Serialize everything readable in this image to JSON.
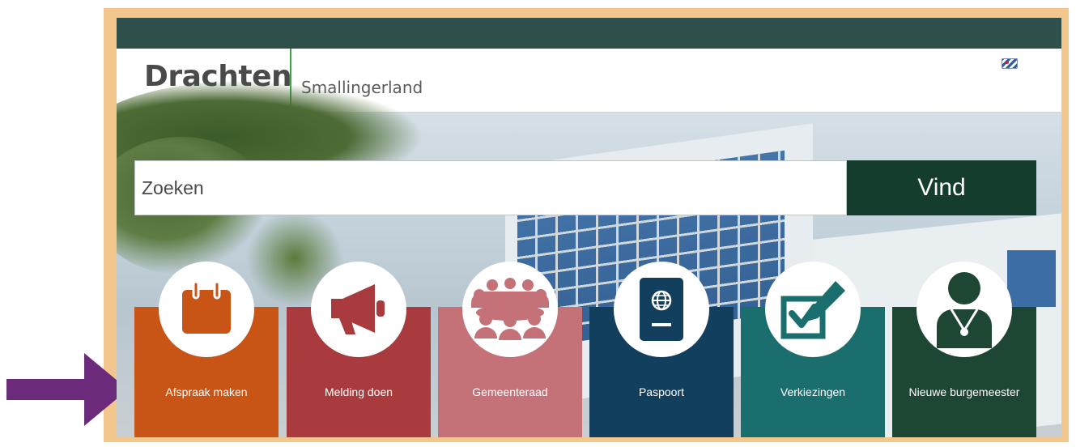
{
  "header": {
    "brand": "Drachten",
    "subbrand": "Smallingerland",
    "language_icon": "frisian-flag-icon"
  },
  "search": {
    "placeholder": "Zoeken",
    "value": "",
    "button_label": "Vind"
  },
  "tiles": [
    {
      "label": "Afspraak maken",
      "icon": "calendar-icon",
      "color": "#c85415"
    },
    {
      "label": "Melding doen",
      "icon": "megaphone-icon",
      "color": "#a93a3d"
    },
    {
      "label": "Gemeenteraad",
      "icon": "council-group-icon",
      "color": "#c57178"
    },
    {
      "label": "Paspoort",
      "icon": "passport-icon",
      "color": "#133f5f"
    },
    {
      "label": "Verkiezingen",
      "icon": "ballot-vote-icon",
      "color": "#1a6e6d"
    },
    {
      "label": "Nieuwe burgemeester",
      "icon": "mayor-person-icon",
      "color": "#1d4733"
    }
  ],
  "colors": {
    "topbar": "#2f4f4a",
    "frame": "#f2c68d",
    "accent_divider": "#3aa34a",
    "search_button": "#143d2d",
    "annotation_arrow": "#6b2a7a"
  }
}
